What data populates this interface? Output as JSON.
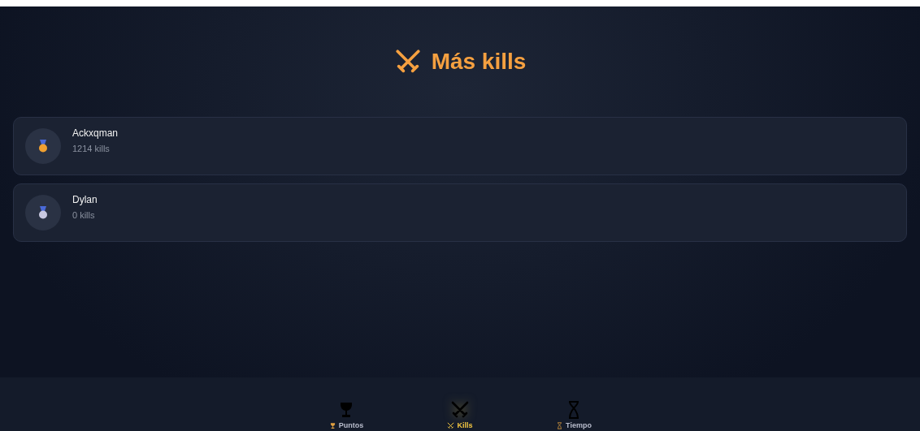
{
  "header": {
    "title": "Más kills"
  },
  "players": [
    {
      "name": "Ackxqman",
      "stat": "1214 kills",
      "color": "#f0a030"
    },
    {
      "name": "Dylan",
      "stat": "0 kills",
      "color": "#c8c8e0"
    }
  ],
  "tabs": [
    {
      "kind": "trophy",
      "label": "Puntos",
      "selected": false
    },
    {
      "kind": "swords",
      "label": "Kills",
      "selected": true
    },
    {
      "kind": "hourglass",
      "label": "Tiempo",
      "selected": false
    }
  ]
}
